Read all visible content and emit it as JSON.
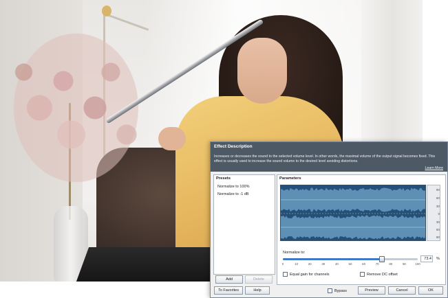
{
  "dialog": {
    "description_title": "Effect Description",
    "description_text": "Increases or decreases the sound to the selected volume level. In other words, the maximal volume of the output signal becomes fixed. This effect is usually used to increase the sound volume to the desired level avoiding distortions.",
    "learn_more": "Learn More",
    "presets": {
      "header": "Presets",
      "items": [
        "Normalize to 100%",
        "Normalize to -1 dB"
      ],
      "add_label": "Add",
      "delete_label": "Delete"
    },
    "parameters": {
      "header": "Parameters",
      "scale_ticks": [
        "90",
        "60",
        "30",
        "0",
        "30",
        "60",
        "90"
      ],
      "normalize_label": "Normalize to:",
      "normalize_value": "73.4",
      "normalize_unit": "%",
      "normalize_fraction": 0.734,
      "slider_ticks": [
        "0",
        "10",
        "20",
        "30",
        "40",
        "50",
        "60",
        "70",
        "80",
        "90",
        "100"
      ],
      "equal_gain_label": "Equal gain for channels",
      "remove_dc_label": "Remove DC offset",
      "equal_gain_checked": false,
      "remove_dc_checked": false
    },
    "footer": {
      "favorites_label": "To Favorites",
      "help_label": "Help",
      "bypass_label": "Bypass",
      "bypass_checked": false,
      "preview_label": "Preview",
      "cancel_label": "Cancel",
      "ok_label": "OK"
    }
  },
  "colors": {
    "description_bg": "#4e5966",
    "waveform_bg": "#23507a",
    "waveform": "#8fc3e6",
    "slider_fill": "#3f7bc4"
  }
}
